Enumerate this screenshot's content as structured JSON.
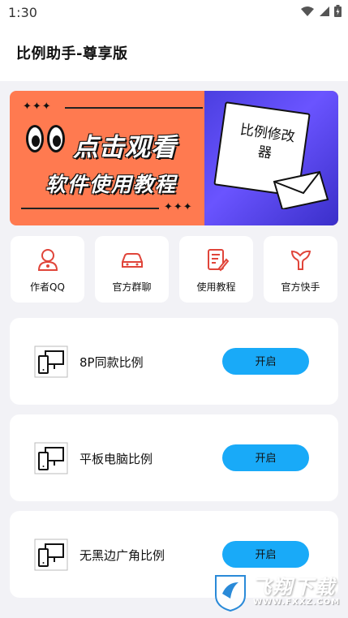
{
  "status_bar": {
    "time": "1:30"
  },
  "header": {
    "title": "比例助手-尊享版"
  },
  "banner": {
    "headline": "点击观看",
    "subline": "软件使用教程",
    "note_text": "比例修改器",
    "colors": {
      "left": "#ff7a50",
      "right": "#5546f0"
    }
  },
  "quick_links": [
    {
      "label": "作者QQ",
      "icon": "user-icon"
    },
    {
      "label": "官方群聊",
      "icon": "car-icon"
    },
    {
      "label": "使用教程",
      "icon": "document-edit-icon"
    },
    {
      "label": "官方快手",
      "icon": "kuaishou-icon"
    }
  ],
  "ratio_options": [
    {
      "name": "8P同款比例",
      "button_label": "开启"
    },
    {
      "name": "平板电脑比例",
      "button_label": "开启"
    },
    {
      "name": "无黑边广角比例",
      "button_label": "开启"
    }
  ],
  "watermark": {
    "name": "飞翔下载",
    "url": "WWW.FXXZ.COM"
  },
  "colors": {
    "accent_button": "#19aaf8",
    "icon_red": "#e0453a",
    "page_bg": "#f2f2f6"
  }
}
